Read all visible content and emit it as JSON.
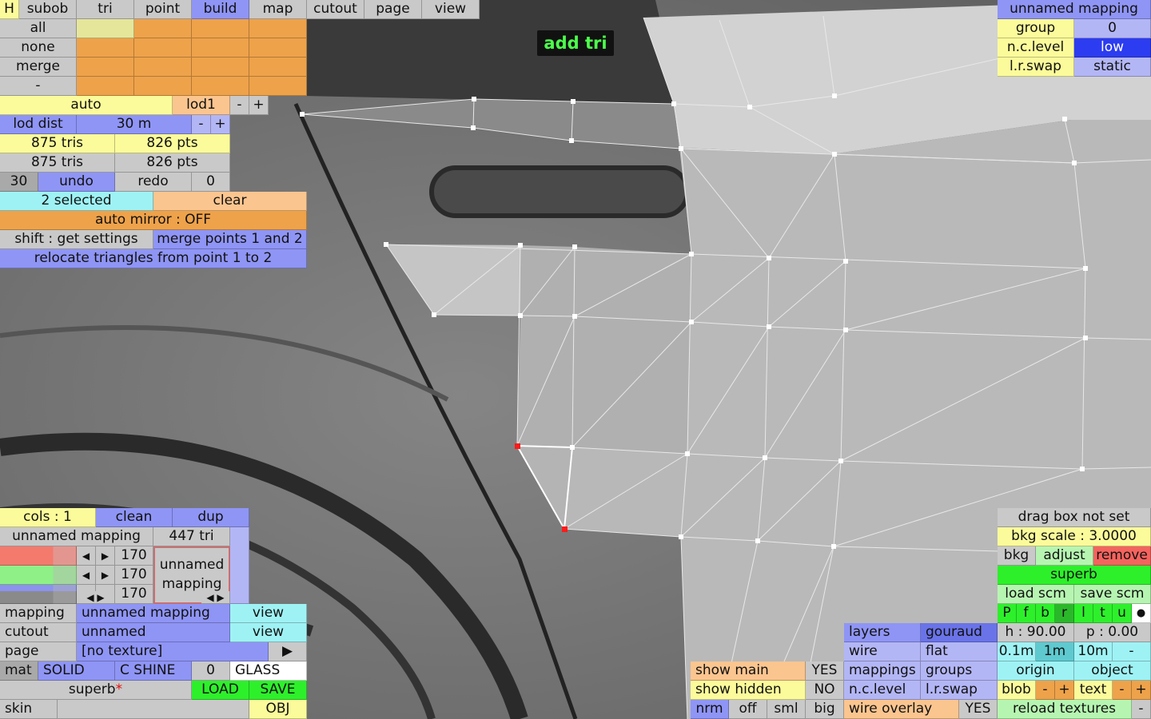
{
  "top_tabs": {
    "h": "H",
    "subob": "subob",
    "tri": "tri",
    "point": "point",
    "build": "build",
    "map": "map",
    "cutout": "cutout",
    "page": "page",
    "view": "view"
  },
  "select_rows": [
    "all",
    "none",
    "merge",
    "-"
  ],
  "auto": "auto",
  "lod_mode": "lod1",
  "minus": "-",
  "plus": "+",
  "lod_dist_label": "lod dist",
  "lod_dist_value": "30 m",
  "stats1": {
    "tris": "875 tris",
    "pts": "826 pts"
  },
  "stats2": {
    "tris": "875 tris",
    "pts": "826 pts"
  },
  "undo_count": "30",
  "undo": "undo",
  "redo": "redo",
  "redo_count": "0",
  "selected": "2 selected",
  "clear": "clear",
  "auto_mirror": "auto mirror : OFF",
  "shift_settings": "shift : get settings",
  "merge_points": "merge points 1 and 2",
  "relocate": "relocate triangles from point 1 to 2",
  "status": "add tri",
  "mapping_panel": {
    "title": "unnamed mapping",
    "group_label": "group",
    "group_value": "0",
    "nc_label": "n.c.level",
    "nc_value": "low",
    "lr_label": "l.r.swap",
    "lr_value": "static"
  },
  "cols": "cols : 1",
  "clean": "clean",
  "dup": "dup",
  "mapping_name": "unnamed mapping",
  "tri_count": "447 tri",
  "colors": [
    {
      "value": "170"
    },
    {
      "value": "170"
    },
    {
      "value": "170"
    }
  ],
  "preview_text": "unnamed mapping",
  "mat_rows": {
    "mapping_label": "mapping",
    "mapping_value": "unnamed mapping",
    "view": "view",
    "cutout_label": "cutout",
    "cutout_value": "unnamed",
    "page_label": "page",
    "page_value": "[no texture]",
    "mat": "mat",
    "solid": "SOLID",
    "cshine": "C SHINE",
    "zero": "0",
    "glass": "GLASS",
    "superb": "superb",
    "star": "*",
    "load": "LOAD",
    "save": "SAVE",
    "skin": "skin",
    "obj": "OBJ"
  },
  "show_panel": {
    "show_main": "show main",
    "yes": "YES",
    "show_hidden": "show hidden",
    "no": "NO",
    "nrm": "nrm",
    "off": "off",
    "sml": "sml",
    "big": "big"
  },
  "layers_panel": {
    "layers": "layers",
    "gouraud": "gouraud",
    "wire": "wire",
    "flat": "flat",
    "mappings": "mappings",
    "groups": "groups",
    "nclevel": "n.c.level",
    "lrswap": "l.r.swap",
    "wire_overlay": "wire overlay",
    "yes": "YES"
  },
  "right_panel": {
    "drag_box": "drag box not set",
    "bkg_scale": "bkg scale : 3.0000",
    "bkg": "bkg",
    "adjust": "adjust",
    "remove": "remove",
    "superb": "superb",
    "load_scm": "load scm",
    "save_scm": "save scm",
    "views": [
      "P",
      "f",
      "b",
      "r",
      "l",
      "t",
      "u",
      "●"
    ],
    "h": "h : 90.00",
    "p": "p : 0.00",
    "dist": [
      "0.1m",
      "1m",
      "10m",
      "-"
    ],
    "origin": "origin",
    "object": "object",
    "blob": "blob",
    "text": "text",
    "reload": "reload textures"
  },
  "colors_theme": {
    "orange": "#eea24a",
    "purple": "#8f95f5",
    "yellow": "#fbfb9b",
    "cyan": "#9ff2f4",
    "green": "#2df02b"
  }
}
